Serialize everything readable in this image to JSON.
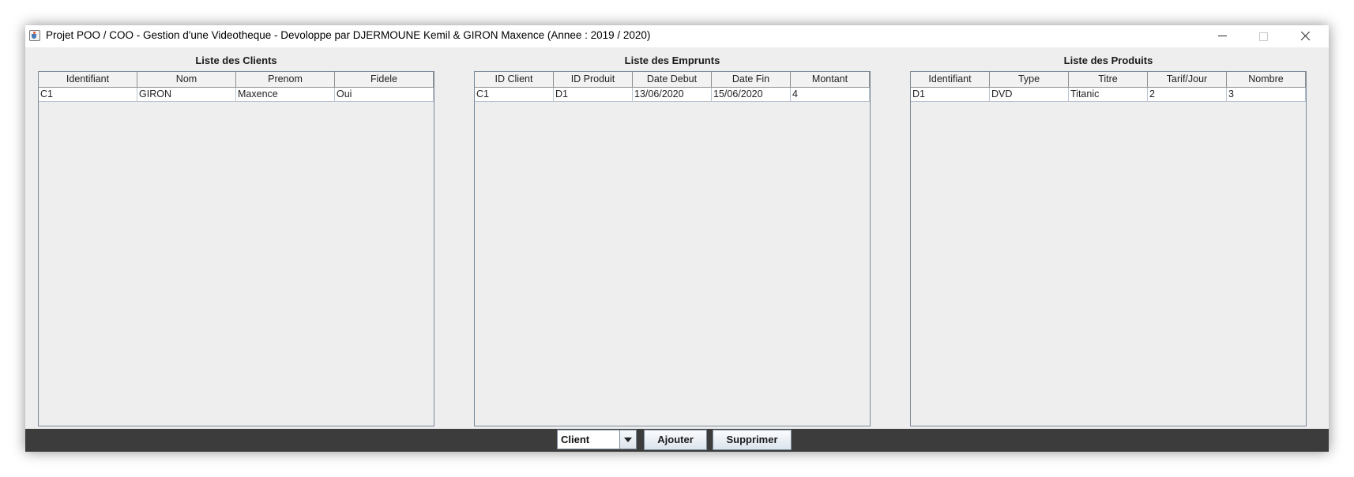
{
  "window": {
    "title": "Projet POO / COO - Gestion d'une Videotheque - Devoloppe par DJERMOUNE Kemil & GIRON Maxence (Annee : 2019 / 2020)"
  },
  "clients": {
    "title": "Liste des Clients",
    "columns": [
      "Identifiant",
      "Nom",
      "Prenom",
      "Fidele"
    ],
    "rows": [
      [
        "C1",
        "GIRON",
        "Maxence",
        "Oui"
      ]
    ]
  },
  "emprunts": {
    "title": "Liste des Emprunts",
    "columns": [
      "ID Client",
      "ID Produit",
      "Date Debut",
      "Date Fin",
      "Montant"
    ],
    "rows": [
      [
        "C1",
        "D1",
        "13/06/2020",
        "15/06/2020",
        "4"
      ]
    ]
  },
  "produits": {
    "title": "Liste des Produits",
    "columns": [
      "Identifiant",
      "Type",
      "Titre",
      "Tarif/Jour",
      "Nombre"
    ],
    "rows": [
      [
        "D1",
        "DVD",
        "Titanic",
        "2",
        "3"
      ]
    ]
  },
  "controls": {
    "type_selected": "Client",
    "add_label": "Ajouter",
    "delete_label": "Supprimer"
  },
  "icons": {
    "app": "java-cup-icon",
    "minimize": "minimize-icon",
    "maximize": "maximize-icon",
    "close": "close-icon",
    "dropdown": "chevron-down-icon"
  }
}
